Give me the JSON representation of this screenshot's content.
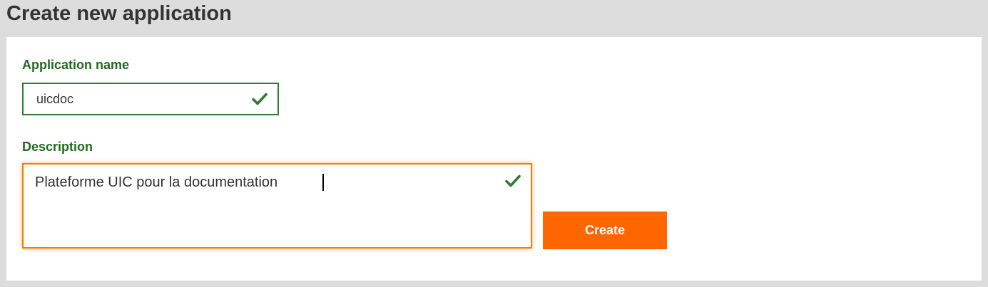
{
  "page": {
    "title": "Create new application"
  },
  "form": {
    "name_field": {
      "label": "Application name",
      "value": "uicdoc",
      "valid": true
    },
    "description_field": {
      "label": "Description",
      "value": "Plateforme UIC pour la documentation",
      "valid": true
    },
    "create_button_label": "Create"
  },
  "icons": {
    "valid": "check-icon"
  },
  "colors": {
    "accent": "#ff6600",
    "valid": "#2e7d32",
    "label": "#1f6b1f",
    "focus_border": "#ff7900"
  }
}
